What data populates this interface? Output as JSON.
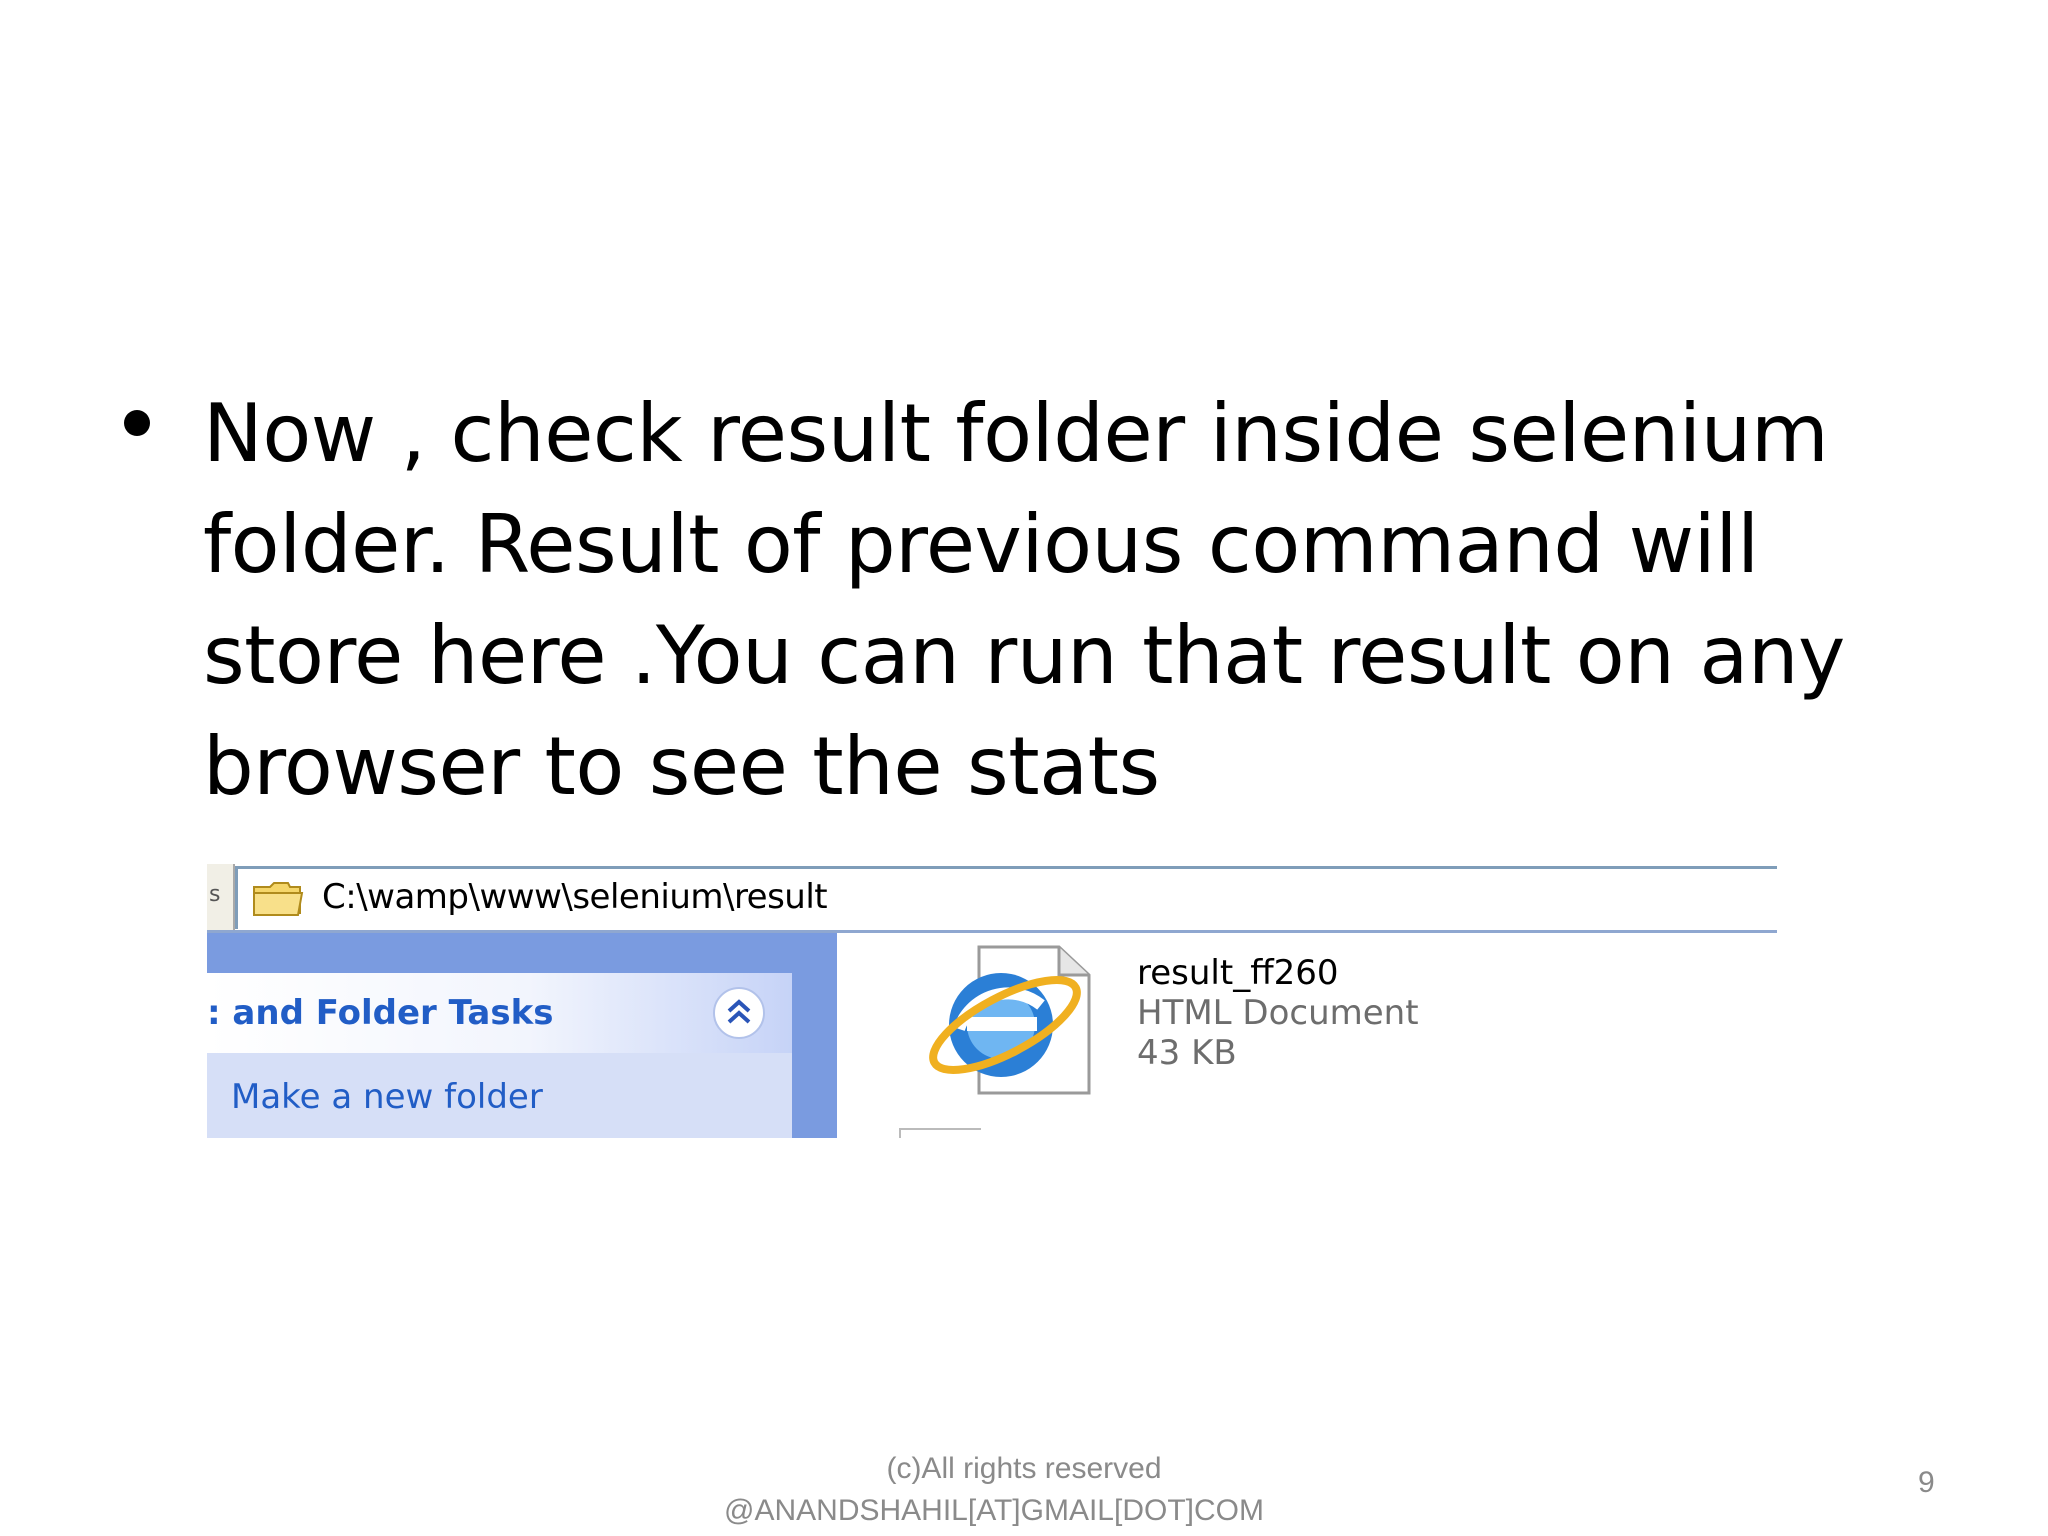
{
  "slide": {
    "bullet_text": "Now , check result folder inside selenium folder. Result of previous command will store here .You can run that result on any browser to see the stats",
    "footer_line1": "(c)All rights reserved",
    "footer_line2": "@ANANDSHAHIL[AT]GMAIL[DOT]COM",
    "page_number": "9"
  },
  "screenshot": {
    "address_left_fragment": "s",
    "address_path": "C:\\wamp\\www\\selenium\\result",
    "address_icon": "folder-icon",
    "task_panel_title": ": and Folder Tasks",
    "task_panel_collapse_icon": "chevron-double-up-icon",
    "task_link": "Make a new folder",
    "file": {
      "icon": "internet-explorer-document-icon",
      "name": "result_ff260",
      "type": "HTML Document",
      "size": "43 KB"
    },
    "colors": {
      "task_pane_blue": "#7a9be0",
      "task_box_bg": "#d6dff7",
      "link_blue": "#215dc6"
    }
  }
}
